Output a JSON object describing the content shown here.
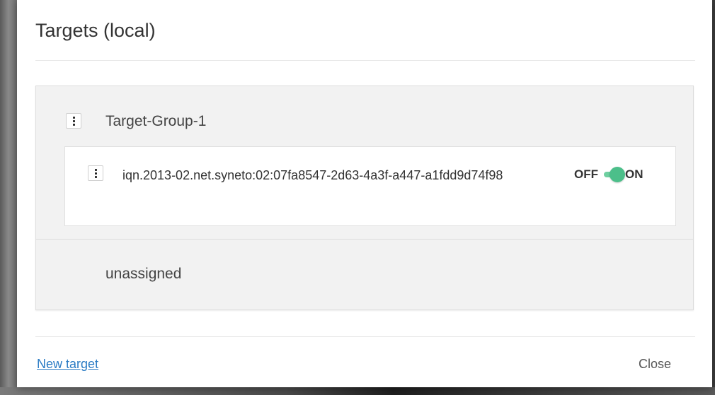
{
  "dialog": {
    "title": "Targets (local)"
  },
  "target_group": {
    "name": "Target-Group-1",
    "targets": [
      {
        "iqn": "iqn.2013-02.net.syneto:02:07fa8547-2d63-4a3f-a447-a1fdd9d74f98",
        "toggle": {
          "off_label": "OFF",
          "on_label": "ON",
          "state": "on"
        }
      }
    ]
  },
  "unassigned": {
    "label": "unassigned"
  },
  "footer": {
    "new_target_label": "New target",
    "close_label": "Close"
  },
  "colors": {
    "toggle_on": "#4cbf8a",
    "link": "#2a7bc4",
    "panel_bg": "#f2f2f2"
  },
  "icons": {
    "group_menu": "kebab-menu-icon",
    "target_menu": "kebab-menu-icon"
  }
}
